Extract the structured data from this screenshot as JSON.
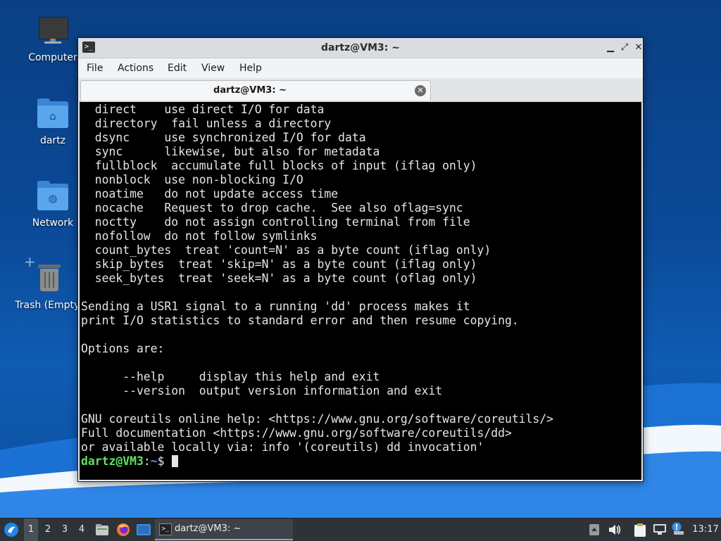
{
  "desktop": {
    "icons": [
      {
        "label": "Computer",
        "icon": "computer-icon"
      },
      {
        "label": "dartz",
        "icon": "home-folder-icon"
      },
      {
        "label": "Network",
        "icon": "network-folder-icon"
      },
      {
        "label": "Trash (Empty)",
        "icon": "trash-icon"
      }
    ]
  },
  "window": {
    "title": "dartz@VM3: ~",
    "controls": {
      "minimize": "▁",
      "maximize": "⤢",
      "close": "✕"
    },
    "menu": [
      "File",
      "Actions",
      "Edit",
      "View",
      "Help"
    ],
    "tab": {
      "label": "dartz@VM3: ~",
      "close": "✕"
    }
  },
  "terminal": {
    "lines": [
      "  direct    use direct I/O for data",
      "  directory  fail unless a directory",
      "  dsync     use synchronized I/O for data",
      "  sync      likewise, but also for metadata",
      "  fullblock  accumulate full blocks of input (iflag only)",
      "  nonblock  use non-blocking I/O",
      "  noatime   do not update access time",
      "  nocache   Request to drop cache.  See also oflag=sync",
      "  noctty    do not assign controlling terminal from file",
      "  nofollow  do not follow symlinks",
      "  count_bytes  treat 'count=N' as a byte count (iflag only)",
      "  skip_bytes  treat 'skip=N' as a byte count (iflag only)",
      "  seek_bytes  treat 'seek=N' as a byte count (oflag only)",
      "",
      "Sending a USR1 signal to a running 'dd' process makes it",
      "print I/O statistics to standard error and then resume copying.",
      "",
      "Options are:",
      "",
      "      --help     display this help and exit",
      "      --version  output version information and exit",
      "",
      "GNU coreutils online help: <https://www.gnu.org/software/coreutils/>",
      "Full documentation <https://www.gnu.org/software/coreutils/dd>",
      "or available locally via: info '(coreutils) dd invocation'"
    ],
    "prompt": {
      "user": "dartz@VM3",
      "sep": ":",
      "path": "~",
      "symbol": "$ "
    }
  },
  "taskbar": {
    "workspaces": [
      "1",
      "2",
      "3",
      "4"
    ],
    "active_workspace": "1",
    "task_label": "dartz@VM3: ~",
    "clock": "13:17"
  }
}
